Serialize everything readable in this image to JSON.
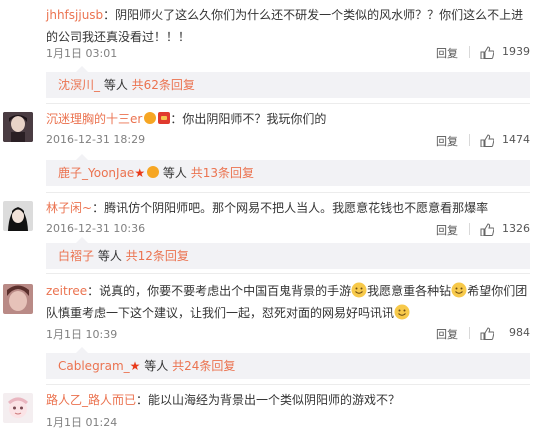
{
  "comments": [
    {
      "user": "jhhfsjjusb",
      "text": "：阴阳师火了这么久你们为什么还不研发一个类似的风水师？？你们这么不上进的公司我还真没看过！！！",
      "time": "1月1日 03:01",
      "reply": "回复",
      "likes": "1939",
      "sub": {
        "user": "沈溟川_",
        "mid": " 等人 ",
        "count": "共62条回复"
      }
    },
    {
      "user": "沉迷理胸的十三er",
      "text": "：你出阴阳师不？我玩你们的",
      "time": "2016-12-31 18:29",
      "reply": "回复",
      "likes": "1474",
      "sub": {
        "user": "鹿子_YoonJae",
        "mid": " 等人 ",
        "count": "共13条回复"
      }
    },
    {
      "user": "林子闲~",
      "text": "：腾讯仿个阴阳师吧。那个网易不把人当人。我愿意花钱也不愿意看那爆率",
      "time": "2016-12-31 10:36",
      "reply": "回复",
      "likes": "1326",
      "sub": {
        "user": "白褶子",
        "mid": " 等人 ",
        "count": "共12条回复"
      }
    },
    {
      "user": "zeitree",
      "text_a": "：说真的，你要不要考虑出个中国百鬼背景的手游",
      "text_b": "我愿意重各种钻",
      "text_c": "希望你们团队慎重考虑一下这个建议，让我们一起，怼死对面的网易好吗讯讯",
      "time": "1月1日 10:39",
      "reply": "回复",
      "likes": "984",
      "sub": {
        "user": "Cablegram_",
        "mid": " 等人 ",
        "count": "共24条回复"
      }
    },
    {
      "user": "路人乙_路人而已",
      "text": "：能以山海经为背景出一个类似阴阳师的游戏不？",
      "time": "1月1日 01:24"
    }
  ],
  "colors": {
    "username": "#eb7350",
    "meta": "#808080",
    "subbg": "#f2f2f5"
  },
  "icons": [
    "thumb-up-icon",
    "vip-badge-icon",
    "red-envelope-icon",
    "smile-emoji-icon",
    "fire-star-icon"
  ]
}
